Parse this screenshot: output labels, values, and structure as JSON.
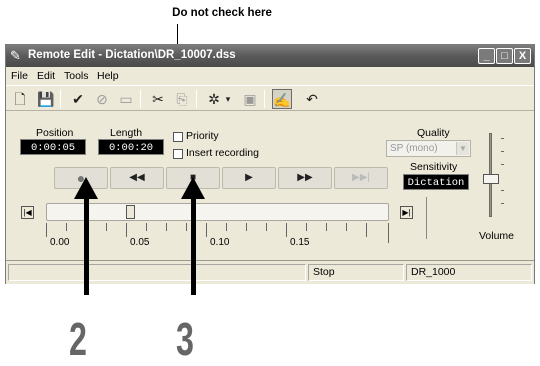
{
  "annotation": {
    "top_label": "Do not check here",
    "callouts": [
      "2",
      "3"
    ]
  },
  "window": {
    "title": "Remote Edit - Dictation\\DR_10007.dss",
    "controls": {
      "minimize": "_",
      "maximize": "□",
      "close": "X"
    }
  },
  "menu": [
    "File",
    "Edit",
    "Tools",
    "Help"
  ],
  "toolbar": {
    "icons": [
      "new-icon",
      "save-icon",
      "check-icon",
      "cancel-icon",
      "book-icon",
      "cut-icon",
      "paste-icon",
      "settings-icon",
      "dropdown-icon",
      "stamp-icon",
      "edit-icon",
      "undo-icon"
    ]
  },
  "controls": {
    "position_label": "Position",
    "position_value": "0:00:05",
    "length_label": "Length",
    "length_value": "0:00:20",
    "priority_label": "Priority",
    "insert_label": "Insert recording",
    "quality_label": "Quality",
    "quality_value": "SP (mono)",
    "sensitivity_label": "Sensitivity",
    "sensitivity_value": "Dictation",
    "volume_label": "Volume"
  },
  "transport": {
    "record": "●",
    "rewind": "◀◀",
    "stop": "■",
    "play": "▶",
    "fast_forward": "▶▶",
    "end": "▶▶|"
  },
  "timeline": {
    "ticks": [
      "0.00",
      "0.05",
      "0.10",
      "0.15"
    ]
  },
  "status": {
    "state": "Stop",
    "file": "DR_1000"
  }
}
